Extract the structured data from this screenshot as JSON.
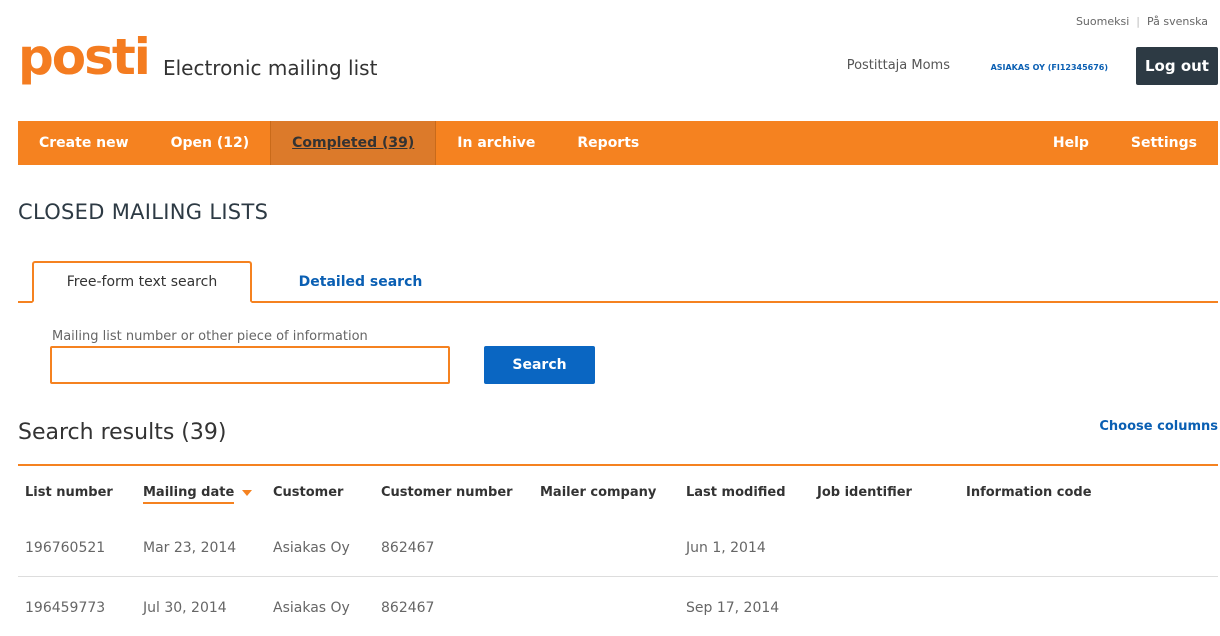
{
  "lang": {
    "fi": "Suomeksi",
    "sv": "På svenska"
  },
  "brand": {
    "logo_text": "posti",
    "app_title": "Electronic mailing list"
  },
  "user": {
    "name": "Postittaja Moms",
    "account": "ASIAKAS OY (FI12345676)",
    "logout_label": "Log out"
  },
  "nav": {
    "items": [
      {
        "label": "Create new"
      },
      {
        "label": "Open (12)"
      },
      {
        "label": "Completed (39)"
      },
      {
        "label": "In archive"
      },
      {
        "label": "Reports"
      }
    ],
    "right": [
      {
        "label": "Help"
      },
      {
        "label": "Settings"
      }
    ],
    "active_index": 2
  },
  "page": {
    "title": "CLOSED MAILING LISTS"
  },
  "tabs": [
    {
      "label": "Free-form text search"
    },
    {
      "label": "Detailed search"
    }
  ],
  "search": {
    "label": "Mailing list number or other piece of information",
    "value": "",
    "button_label": "Search"
  },
  "results": {
    "title": "Search results (39)",
    "choose_columns": "Choose columns",
    "columns": [
      "List number",
      "Mailing date",
      "Customer",
      "Customer number",
      "Mailer company",
      "Last modified",
      "Job identifier",
      "Information code"
    ],
    "sorted_column": "Mailing date",
    "rows": [
      [
        "196760521",
        "Mar 23, 2014",
        "Asiakas Oy",
        "862467",
        "",
        "Jun 1, 2014",
        "",
        ""
      ],
      [
        "196459773",
        "Jul 30, 2014",
        "Asiakas Oy",
        "862467",
        "",
        "Sep 17, 2014",
        "",
        ""
      ]
    ]
  },
  "colors": {
    "accent": "#f58220",
    "link": "#0a5fb3",
    "button": "#0a66c2",
    "dark": "#2d3a44"
  }
}
